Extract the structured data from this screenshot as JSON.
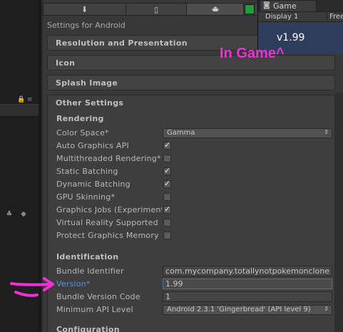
{
  "left_pane": {
    "lock_glyph": "🔒",
    "menu_glyph": "≡"
  },
  "inspector": {
    "tabs": [
      {
        "name": "standalone",
        "icon": "download-icon"
      },
      {
        "name": "ios",
        "icon": "phone-icon"
      },
      {
        "name": "android",
        "icon": "android-icon",
        "active": true
      },
      {
        "name": "webgl",
        "icon": "webgl-icon"
      }
    ],
    "settings_for": "Settings for Android",
    "sections": {
      "resolution": "Resolution and Presentation",
      "icon": "Icon",
      "splash": "Splash Image",
      "other": "Other Settings"
    },
    "rendering": {
      "title": "Rendering",
      "color_space_label": "Color Space*",
      "color_space_value": "Gamma",
      "rows": [
        {
          "label": "Auto Graphics API",
          "checked": true
        },
        {
          "label": "Multithreaded Rendering*",
          "checked": false
        },
        {
          "label": "Static Batching",
          "checked": true
        },
        {
          "label": "Dynamic Batching",
          "checked": true
        },
        {
          "label": "GPU Skinning*",
          "checked": false
        },
        {
          "label": "Graphics Jobs (Experimental)",
          "checked": true
        },
        {
          "label": "Virtual Reality Supported",
          "checked": false
        },
        {
          "label": "Protect Graphics Memory",
          "checked": false
        }
      ]
    },
    "identification": {
      "title": "Identification",
      "bundle_identifier_label": "Bundle Identifier",
      "bundle_identifier_value": "com.mycompany.totallynotpokemonclone",
      "version_label": "Version*",
      "version_value": "1.99",
      "bundle_version_code_label": "Bundle Version Code",
      "bundle_version_code_value": "1",
      "min_api_label": "Minimum API Level",
      "min_api_value": "Android 2.3.1 'Gingerbread' (API level 9)"
    },
    "configuration_title": "Configuration"
  },
  "game_window": {
    "tab_label": "Game",
    "display_label": "Display 1",
    "free_label": "Free",
    "version_text": "v1.99"
  },
  "annotation": {
    "in_game_text": "In Game^",
    "color": "#f02fd4"
  },
  "colors": {
    "panel_bg": "#383838",
    "game_bg": "#2f3d5c",
    "link_blue": "#5a8ee6"
  }
}
